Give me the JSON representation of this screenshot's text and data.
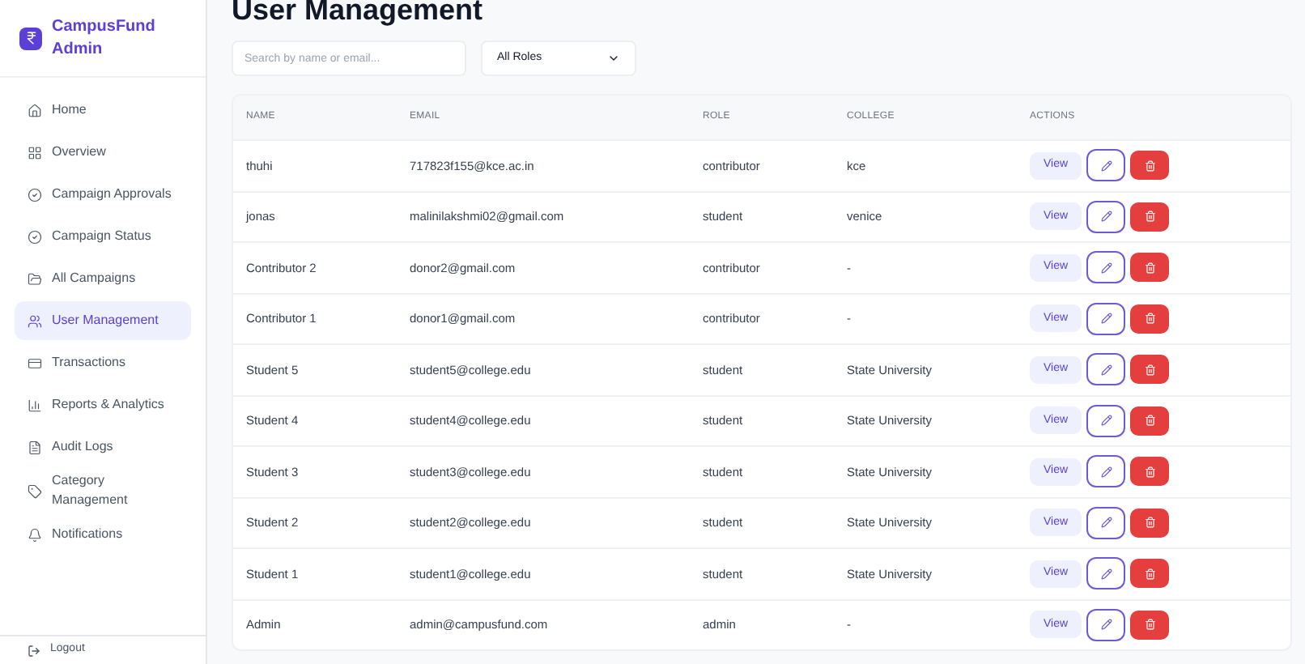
{
  "brand": {
    "line_1": "CampusFund",
    "line_2": "Admin"
  },
  "sidebar": {
    "items": [
      {
        "label": "Home",
        "selected": false
      },
      {
        "label": "Overview",
        "selected": false
      },
      {
        "label": "Campaign Approvals",
        "selected": false
      },
      {
        "label": "Campaign Status",
        "selected": false
      },
      {
        "label": "All Campaigns",
        "selected": false
      },
      {
        "label": "User Management",
        "selected": true
      },
      {
        "label": "Transactions",
        "selected": false
      },
      {
        "label": "Reports & Analytics",
        "selected": false
      },
      {
        "label": "Audit Logs",
        "selected": false
      },
      {
        "label": "Category Management",
        "selected": false
      },
      {
        "label": "Notifications",
        "selected": false
      }
    ],
    "logout": "Logout"
  },
  "page_title": "User Management",
  "search": {
    "placeholder": "Search by name or email..."
  },
  "role_filter": {
    "value": "All Roles"
  },
  "table": {
    "columns": [
      "NAME",
      "EMAIL",
      "ROLE",
      "COLLEGE",
      "ACTIONS"
    ],
    "rows": [
      {
        "name": "thuhi",
        "email": "717823f155@kce.ac.in",
        "role": "contributor",
        "college": "kce",
        "view": "View"
      },
      {
        "name": "jonas",
        "email": "malinilakshmi02@gmail.com",
        "role": "student",
        "college": "venice",
        "view": "View"
      },
      {
        "name": "Contributor 2",
        "email": "donor2@gmail.com",
        "role": "contributor",
        "college": "-",
        "view": "View"
      },
      {
        "name": "Contributor 1",
        "email": "donor1@gmail.com",
        "role": "contributor",
        "college": "-",
        "view": "View"
      },
      {
        "name": "Student 5",
        "email": "student5@college.edu",
        "role": "student",
        "college": "State University",
        "view": "View"
      },
      {
        "name": "Student 4",
        "email": "student4@college.edu",
        "role": "student",
        "college": "State University",
        "view": "View"
      },
      {
        "name": "Student 3",
        "email": "student3@college.edu",
        "role": "student",
        "college": "State University",
        "view": "View"
      },
      {
        "name": "Student 2",
        "email": "student2@college.edu",
        "role": "student",
        "college": "State University",
        "view": "View"
      },
      {
        "name": "Student 1",
        "email": "student1@college.edu",
        "role": "student",
        "college": "State University",
        "view": "View"
      },
      {
        "name": "Admin",
        "email": "admin@campusfund.com",
        "role": "admin",
        "college": "-",
        "view": "View"
      }
    ]
  }
}
